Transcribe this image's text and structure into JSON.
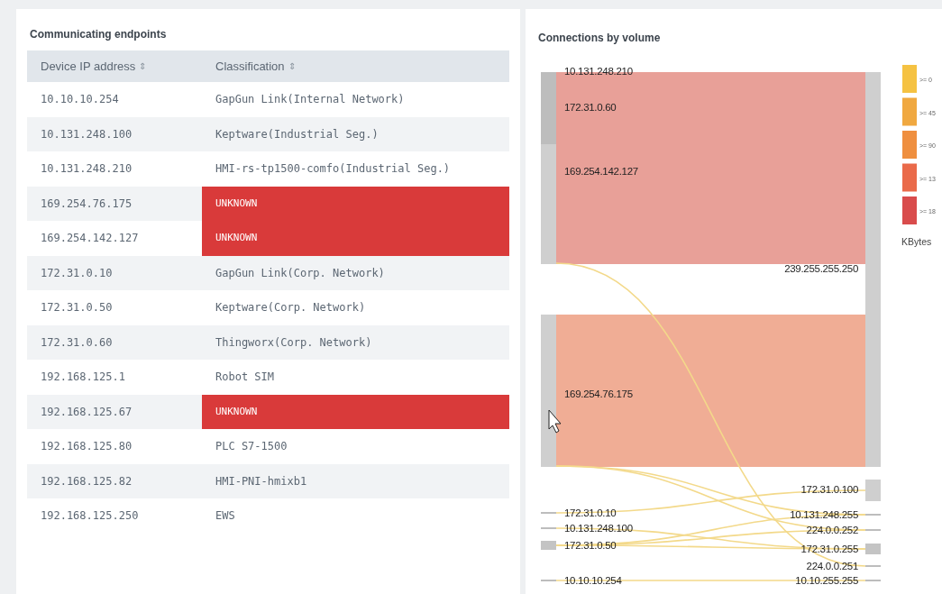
{
  "endpoints": {
    "title": "Communicating endpoints",
    "columns": [
      {
        "label": "Device IP address",
        "sort_icon": "⇕"
      },
      {
        "label": "Classification",
        "sort_icon": "⇕"
      }
    ],
    "rows": [
      {
        "ip": "10.10.10.254",
        "classification": "GapGun Link(Internal Network)",
        "flagged": false
      },
      {
        "ip": "10.131.248.100",
        "classification": "Keptware(Industrial Seg.)",
        "flagged": false
      },
      {
        "ip": "10.131.248.210",
        "classification": "HMI-rs-tp1500-comfo(Industrial Seg.)",
        "flagged": false
      },
      {
        "ip": "169.254.76.175",
        "classification": "UNKNOWN",
        "flagged": true
      },
      {
        "ip": "169.254.142.127",
        "classification": "UNKNOWN",
        "flagged": true
      },
      {
        "ip": "172.31.0.10",
        "classification": "GapGun Link(Corp. Network)",
        "flagged": false
      },
      {
        "ip": "172.31.0.50",
        "classification": "Keptware(Corp. Network)",
        "flagged": false
      },
      {
        "ip": "172.31.0.60",
        "classification": "Thingworx(Corp. Network)",
        "flagged": false
      },
      {
        "ip": "192.168.125.1",
        "classification": "Robot SIM",
        "flagged": false
      },
      {
        "ip": "192.168.125.67",
        "classification": "UNKNOWN",
        "flagged": true
      },
      {
        "ip": "192.168.125.80",
        "classification": "PLC S7-1500",
        "flagged": false
      },
      {
        "ip": "192.168.125.82",
        "classification": "HMI-PNI-hmixb1",
        "flagged": false
      },
      {
        "ip": "192.168.125.250",
        "classification": "EWS",
        "flagged": false
      }
    ]
  },
  "connections": {
    "title": "Connections by volume",
    "sources": [
      {
        "label": "10.131.248.210"
      },
      {
        "label": "172.31.0.60"
      },
      {
        "label": "169.254.142.127"
      },
      {
        "label": "169.254.76.175"
      },
      {
        "label": "172.31.0.10"
      },
      {
        "label": "10.131.248.100"
      },
      {
        "label": "172.31.0.50"
      },
      {
        "label": "10.10.10.254"
      }
    ],
    "targets": [
      {
        "label": "239.255.255.250"
      },
      {
        "label": "172.31.0.100"
      },
      {
        "label": "10.131.248.255"
      },
      {
        "label": "224.0.0.252"
      },
      {
        "label": "172.31.0.255"
      },
      {
        "label": "224.0.0.251"
      },
      {
        "label": "10.10.255.255"
      }
    ],
    "legend": [
      {
        "label": ">= 0",
        "color": "#f5c242"
      },
      {
        "label": ">= 45",
        "color": "#f0a840"
      },
      {
        "label": ">= 90",
        "color": "#ef8f3f"
      },
      {
        "label": ">= 13",
        "color": "#ea6a4a"
      },
      {
        "label": ">= 18",
        "color": "#d94c4c"
      }
    ],
    "legend_unit": "KBytes"
  }
}
